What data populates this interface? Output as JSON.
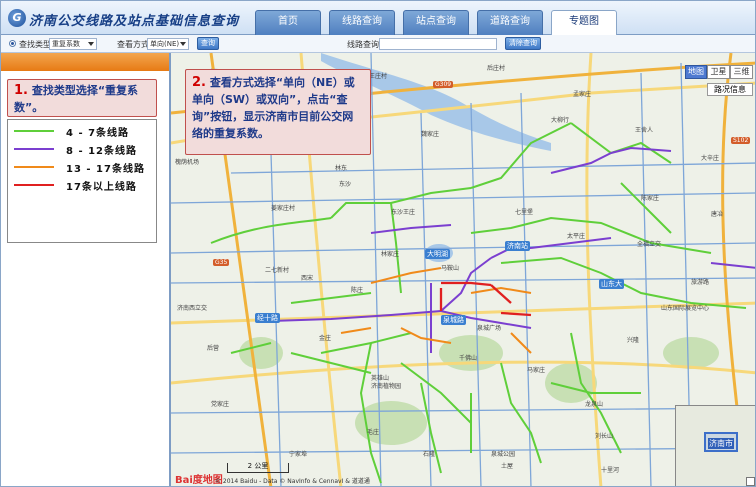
{
  "app": {
    "logo_letter": "G",
    "title": "济南公交线路及站点基础信息查询"
  },
  "nav": {
    "tabs": [
      "首页",
      "线路查询",
      "站点查询",
      "道路查询",
      "专题图"
    ],
    "active": 4
  },
  "toolbar": {
    "search_type_label": "查找类型",
    "search_type_value": "重复系数",
    "view_mode_label": "查看方式",
    "view_mode_value": "单向(NE)",
    "query_button": "查询",
    "road_query_label": "线路查询",
    "road_query_value": "",
    "clear_button": "清除查询"
  },
  "callouts": {
    "c1": {
      "num": "1.",
      "text": "查找类型选择“重复系数”。"
    },
    "c2": {
      "num": "2.",
      "text": "查看方式选择“单向（NE）或单向（SW）或双向”，点击“查询”按钮，显示济南市目前公交网络的重复系数。"
    }
  },
  "legend": [
    {
      "label": "4 - 7条线路",
      "color": "#5fcf3a"
    },
    {
      "label": "8 - 12条线路",
      "color": "#7b3fd0"
    },
    {
      "label": "13 - 17条线路",
      "color": "#f08a1a"
    },
    {
      "label": "17条以上线路",
      "color": "#e02020"
    }
  ],
  "map": {
    "view_buttons": [
      "地图",
      "卫星",
      "三维"
    ],
    "traffic_button": "路况信息",
    "scale_label": "2 公里",
    "baidu_logo": "Bai度地图",
    "copyright": "© 2014 Baidu - Data © NavInfo & CennavI & 道道通",
    "minimap_city": "济南市",
    "colors": {
      "minor_road": "#7ea6d8",
      "major_road": "#f7d87a",
      "highway": "#f0b23c",
      "water": "#a8c8e8",
      "park": "#c8e0b4"
    },
    "road_badges": [
      "大明湖",
      "泉城路",
      "经十路",
      "山东大",
      "济南站"
    ],
    "highway_badges": [
      "G309",
      "G35",
      "S102",
      "G2"
    ],
    "place_labels": [
      "王庄村",
      "后庄村",
      "孟家庄",
      "大柳行",
      "魏家庄",
      "槐荫机场",
      "姜家庄村",
      "东沙王庄",
      "林东",
      "东沙",
      "济南西立交",
      "西宋",
      "陈庄",
      "林家庄",
      "金庄",
      "王舍人",
      "七里堡",
      "太平庄",
      "泉城广场",
      "千佛山",
      "英雄山",
      "济南植物园",
      "龙泉山",
      "马家庄",
      "山东国际展览中心",
      "旅游路",
      "全福立交",
      "宁家埠",
      "唐冶",
      "党家庄",
      "兴隆",
      "二七新村",
      "大辛庄",
      "马鞍山",
      "毛庄",
      "刘长山",
      "后营",
      "陈家庄",
      "十里河",
      "泉城公园",
      "土屋",
      "石隆"
    ]
  }
}
